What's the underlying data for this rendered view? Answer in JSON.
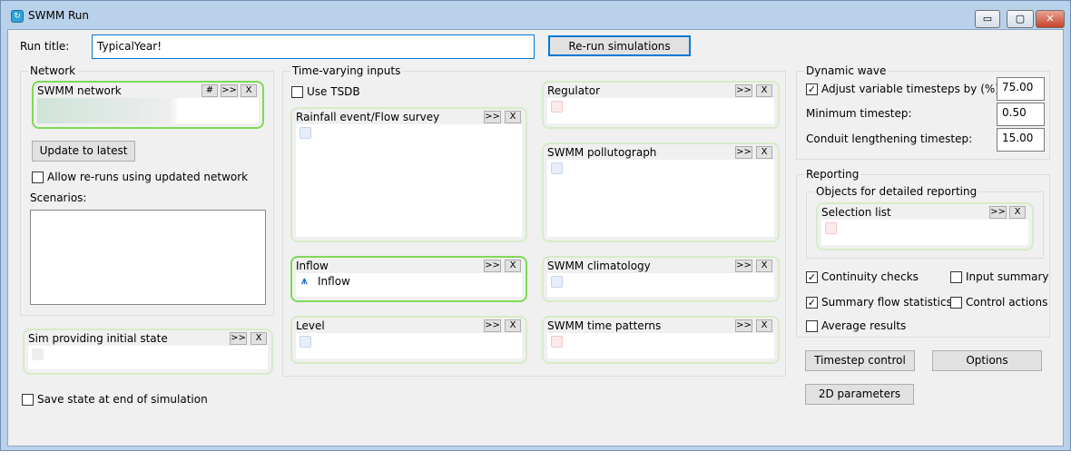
{
  "window": {
    "title": "SWMM Run",
    "minimize": "▭",
    "maximize": "▢",
    "close": "✕"
  },
  "run_title": {
    "label": "Run title:",
    "value": "TypicalYear!",
    "rerun_button": "Re-run simulations"
  },
  "network": {
    "group_label": "Network",
    "panel_title": "SWMM network",
    "hash_btn": "#",
    "more_btn": ">>",
    "clear_btn": "X",
    "update_button": "Update to latest",
    "allow_reruns": "Allow re-runs using updated network",
    "scenarios_label": "Scenarios:"
  },
  "initial_state": {
    "panel_title": "Sim providing initial state",
    "more_btn": ">>",
    "clear_btn": "X",
    "save_state": "Save state at end of simulation"
  },
  "time_varying": {
    "group_label": "Time-varying inputs",
    "use_tsdb": "Use TSDB",
    "panels": [
      {
        "title": "Rainfall event/Flow survey",
        "item": ""
      },
      {
        "title": "Inflow",
        "item": "Inflow"
      },
      {
        "title": "Level",
        "item": ""
      },
      {
        "title": "Regulator",
        "item": ""
      },
      {
        "title": "SWMM pollutograph",
        "item": ""
      },
      {
        "title": "SWMM climatology",
        "item": ""
      },
      {
        "title": "SWMM time patterns",
        "item": ""
      }
    ],
    "more_btn": ">>",
    "clear_btn": "X"
  },
  "dynamic_wave": {
    "group_label": "Dynamic wave",
    "adjust_label": "Adjust variable timesteps by (%):",
    "adjust_value": "75.00",
    "adjust_checked": true,
    "min_label": "Minimum timestep:",
    "min_value": "0.50",
    "conduit_label": "Conduit lengthening timestep:",
    "conduit_value": "15.00"
  },
  "reporting": {
    "group_label": "Reporting",
    "objects_label": "Objects for detailed reporting",
    "selection_title": "Selection list",
    "more_btn": ">>",
    "clear_btn": "X",
    "continuity": "Continuity checks",
    "input_summary": "Input summary",
    "summary_flow": "Summary flow statistics",
    "control_actions": "Control actions",
    "average_results": "Average results"
  },
  "buttons": {
    "timestep_control": "Timestep control",
    "options": "Options",
    "params_2d": "2D parameters"
  }
}
